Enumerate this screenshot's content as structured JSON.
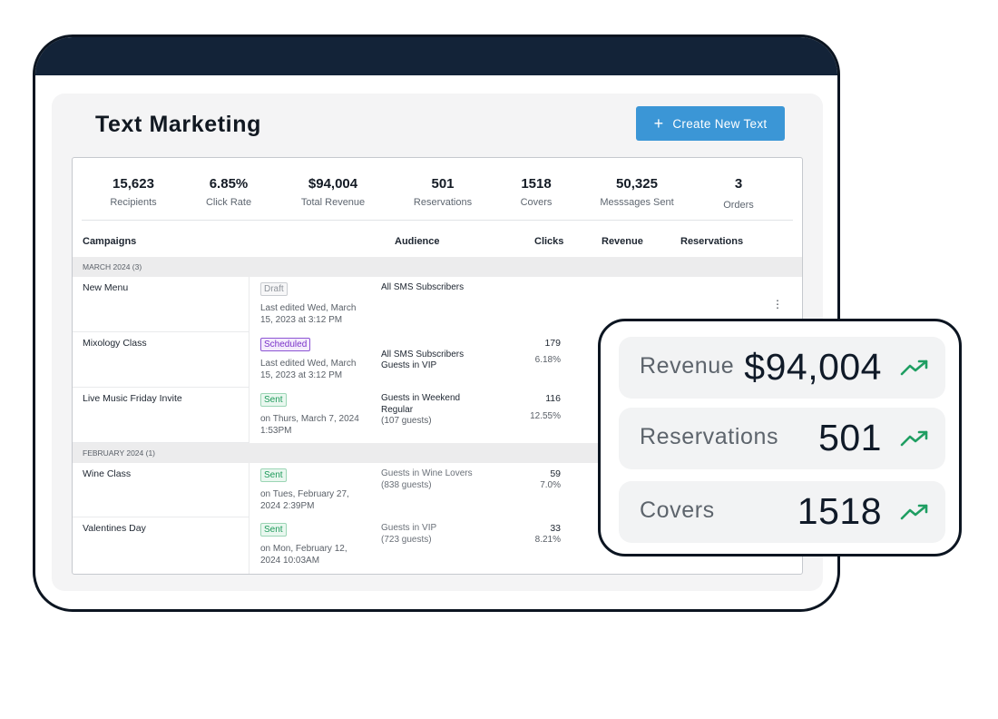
{
  "header": {
    "title": "Text Marketing",
    "create_button": "Create New Text",
    "create_icon": "+"
  },
  "stats": [
    {
      "value": "15,623",
      "label": "Recipients"
    },
    {
      "value": "6.85%",
      "label": "Click Rate"
    },
    {
      "value": "$94,004",
      "label": "Total Revenue"
    },
    {
      "value": "501",
      "label": "Reservations"
    },
    {
      "value": "1518",
      "label": "Covers"
    },
    {
      "value": "50,325",
      "label": "Messsages Sent"
    },
    {
      "value": "3",
      "label": "Orders"
    }
  ],
  "table": {
    "columns": [
      "Campaigns",
      "Audience",
      "Clicks",
      "Revenue",
      "Reservations"
    ],
    "groups": [
      {
        "label": "MARCH 2024 (3)",
        "rows": [
          {
            "name": "New Menu",
            "status": "Draft",
            "when": "Last edited Wed, March 15, 2023 at 3:12 PM",
            "audience": "All SMS Subscribers",
            "audience_sub": "",
            "clicks": "",
            "rate": ""
          },
          {
            "name": "Mixology Class",
            "status": "Scheduled",
            "when": "Last edited Wed, March 15, 2023 at 3:12 PM",
            "audience": "All SMS Subscribers\nGuests in VIP",
            "audience_sub": "",
            "clicks": "179",
            "rate": "6.18%"
          },
          {
            "name": "Live Music Friday Invite",
            "status": "Sent",
            "when": "on Thurs, March 7, 2024 1:53PM",
            "audience": "Guests in Weekend Regular",
            "audience_sub": "(107 guests)",
            "clicks": "116",
            "rate": "12.55%"
          }
        ]
      },
      {
        "label": "FEBRUARY 2024 (1)",
        "rows": [
          {
            "name": "Wine Class",
            "status": "Sent",
            "when": "on Tues, February 27, 2024 2:39PM",
            "audience": "Guests in Wine Lovers",
            "audience_sub": "(838 guests)",
            "clicks": "59",
            "rate": "7.0%"
          },
          {
            "name": "Valentines Day",
            "status": "Sent",
            "when": "on Mon, February 12, 2024 10:03AM",
            "audience": "Guests in VIP",
            "audience_sub": "(723 guests)",
            "clicks": "33",
            "rate": "8.21%"
          }
        ]
      }
    ],
    "row_menu_icon": "⋮"
  },
  "highlights": [
    {
      "label": "Revenue",
      "value": "$94,004",
      "icon": "trending-up-icon"
    },
    {
      "label": "Reservations",
      "value": "501",
      "icon": "trending-up-icon"
    },
    {
      "label": "Covers",
      "value": "1518",
      "icon": "trending-up-icon"
    }
  ],
  "colors": {
    "device_bar": "#132338",
    "primary_button": "#3b96d6",
    "trend": "#1f9e62",
    "sent": "#1e9a5a",
    "scheduled": "#7a33c9"
  }
}
